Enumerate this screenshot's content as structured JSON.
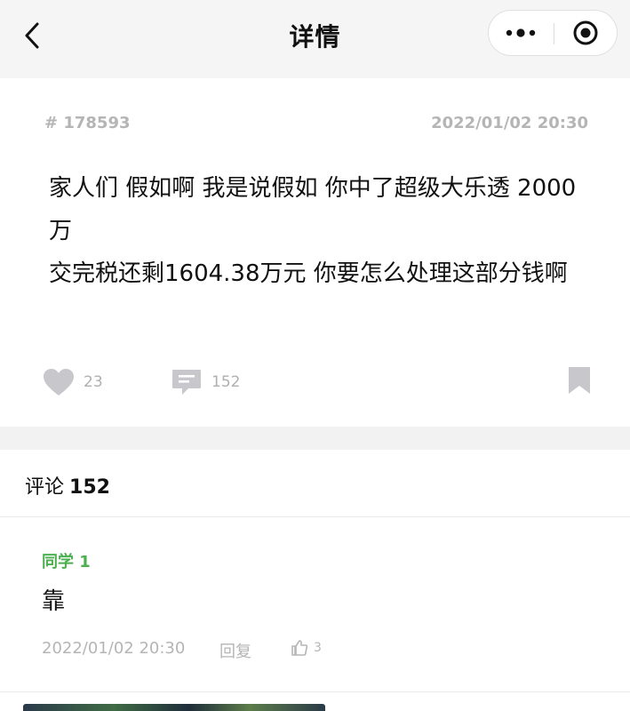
{
  "header": {
    "title": "详情",
    "back_icon": "chevron-left-icon",
    "more_icon": "more-dots-icon",
    "close_icon": "target-close-icon"
  },
  "post": {
    "id": "# 178593",
    "time": "2022/01/02 20:30",
    "lines": [
      "家人们 假如啊 我是说假如 你中了超级大乐透 2000万",
      "交完税还剩1604.38万元 你要怎么处理这部分钱啊"
    ],
    "likes": "23",
    "comments": "152"
  },
  "comments_section": {
    "label": "评论",
    "count": "152",
    "items": [
      {
        "author": "同学 1",
        "text": "靠",
        "time": "2022/01/02 20:30",
        "reply_label": "回复",
        "likes": "3"
      }
    ]
  },
  "colors": {
    "accent_green": "#4caf50",
    "muted_gray": "#b5b5b5",
    "icon_gray": "#c7c7cc"
  }
}
